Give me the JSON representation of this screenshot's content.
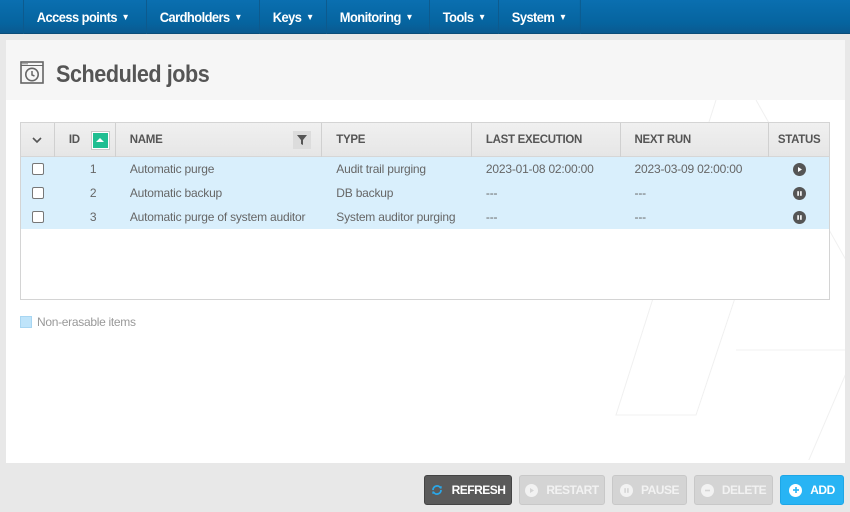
{
  "nav": {
    "items": [
      {
        "label": "Access points"
      },
      {
        "label": "Cardholders"
      },
      {
        "label": "Keys"
      },
      {
        "label": "Monitoring"
      },
      {
        "label": "Tools"
      },
      {
        "label": "System"
      }
    ]
  },
  "page": {
    "title": "Scheduled jobs",
    "icon": "scheduled-clock-window-icon"
  },
  "table": {
    "columns": {
      "select": "",
      "id": "ID",
      "name": "NAME",
      "type": "TYPE",
      "last_execution": "LAST EXECUTION",
      "next_run": "NEXT RUN",
      "status": "STATUS"
    },
    "sort": {
      "column": "ID",
      "direction": "ascending"
    },
    "rows": [
      {
        "id": "1",
        "name": "Automatic purge",
        "type": "Audit trail purging",
        "last_execution": "2023-01-08 02:00:00",
        "next_run": "2023-03-09 02:00:00",
        "status": "running",
        "status_icon": "play-icon",
        "non_erasable": true
      },
      {
        "id": "2",
        "name": "Automatic backup",
        "type": "DB backup",
        "last_execution": "---",
        "next_run": "---",
        "status": "paused",
        "status_icon": "pause-icon",
        "non_erasable": true
      },
      {
        "id": "3",
        "name": "Automatic purge of system auditor",
        "type": "System auditor purging",
        "last_execution": "---",
        "next_run": "---",
        "status": "paused",
        "status_icon": "pause-icon",
        "non_erasable": true
      }
    ]
  },
  "legend": {
    "label": "Non-erasable items",
    "color": "#bfe4fa"
  },
  "buttons": {
    "refresh": "REFRESH",
    "restart": "RESTART",
    "pause": "PAUSE",
    "delete": "DELETE",
    "add": "ADD"
  },
  "colors": {
    "nav_bg": "#06649f",
    "sort_accent": "#1fbe91",
    "row_highlight": "#d9effc",
    "add_button": "#28b4f4",
    "refresh_button": "#5a5a5a"
  }
}
